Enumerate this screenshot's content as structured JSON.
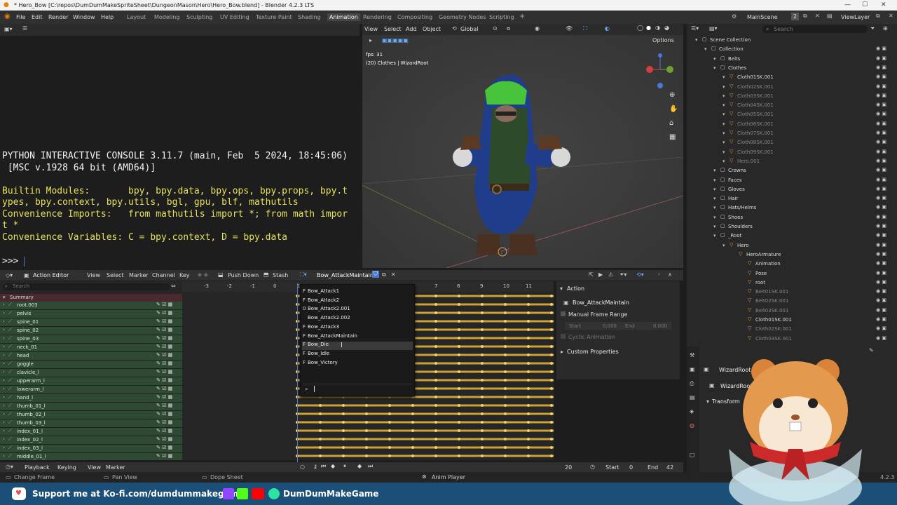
{
  "window": {
    "title": "* Hero_Bow [C:\\repos\\DumDumMakeSpriteSheet\\DungeonMason\\Hero\\Hero_Bow.blend] - Blender 4.2.3 LTS"
  },
  "menubar": {
    "items": [
      "File",
      "Edit",
      "Render",
      "Window",
      "Help"
    ],
    "workspaces": [
      "Layout",
      "Modeling",
      "Sculpting",
      "UV Editing",
      "Texture Paint",
      "Shading",
      "Animation",
      "Rendering",
      "Compositing",
      "Geometry Nodes",
      "Scripting"
    ],
    "active_workspace": "Animation",
    "add_tab": "+",
    "scene": "MainScene",
    "scene_count": "2",
    "view_layer": "ViewLayer"
  },
  "console": {
    "lines": [
      "PYTHON INTERACTIVE CONSOLE 3.11.7 (main, Feb  5 2024, 18:45:06)",
      " [MSC v.1928 64 bit (AMD64)]",
      "",
      "Builtin Modules:       bpy, bpy.data, bpy.ops, bpy.props, bpy.t",
      "ypes, bpy.context, bpy.utils, bgl, gpu, blf, mathutils",
      "Convenience Imports:   from mathutils import *; from math impor",
      "t *",
      "Convenience Variables: C = bpy.context, D = bpy.data"
    ],
    "prompt": ">>> "
  },
  "viewport": {
    "menu": [
      "View",
      "Select",
      "Add",
      "Object"
    ],
    "orientation": "Global",
    "options": "Options",
    "fps": "fps: 31",
    "info": "(20) Clothes | WizardRoot"
  },
  "outliner": {
    "search_placeholder": "Search",
    "rows": [
      {
        "label": "Scene Collection",
        "indent": 0,
        "dim": false
      },
      {
        "label": "Collection",
        "indent": 1,
        "dim": false
      },
      {
        "label": "Belts",
        "indent": 2,
        "dim": false
      },
      {
        "label": "Clothes",
        "indent": 2,
        "dim": false
      },
      {
        "label": "Cloth01SK.001",
        "indent": 3,
        "dim": false
      },
      {
        "label": "Cloth02SK.001",
        "indent": 3,
        "dim": true
      },
      {
        "label": "Cloth03SK.001",
        "indent": 3,
        "dim": true
      },
      {
        "label": "Cloth04SK.001",
        "indent": 3,
        "dim": true
      },
      {
        "label": "Cloth05SK.001",
        "indent": 3,
        "dim": true
      },
      {
        "label": "Cloth06SK.001",
        "indent": 3,
        "dim": true
      },
      {
        "label": "Cloth07SK.001",
        "indent": 3,
        "dim": true
      },
      {
        "label": "Cloth08SK.001",
        "indent": 3,
        "dim": true
      },
      {
        "label": "Cloth09SK.001",
        "indent": 3,
        "dim": true
      },
      {
        "label": "Hero.001",
        "indent": 3,
        "dim": true
      },
      {
        "label": "Crowns",
        "indent": 2,
        "dim": false
      },
      {
        "label": "Faces",
        "indent": 2,
        "dim": false
      },
      {
        "label": "Gloves",
        "indent": 2,
        "dim": false
      },
      {
        "label": "Hair",
        "indent": 2,
        "dim": false
      },
      {
        "label": "Hats/Helms",
        "indent": 2,
        "dim": false
      },
      {
        "label": "Shoes",
        "indent": 2,
        "dim": false
      },
      {
        "label": "Shoulders",
        "indent": 2,
        "dim": false
      },
      {
        "label": "_Root",
        "indent": 2,
        "dim": false
      },
      {
        "label": "Hero",
        "indent": 3,
        "dim": false
      },
      {
        "label": "HeroArmature",
        "indent": 4,
        "dim": false
      },
      {
        "label": "Animation",
        "indent": 5,
        "dim": false
      },
      {
        "label": "Pose",
        "indent": 5,
        "dim": false
      },
      {
        "label": "root",
        "indent": 5,
        "dim": false
      },
      {
        "label": "Belt01SK.001",
        "indent": 5,
        "dim": true
      },
      {
        "label": "Belt02SK.001",
        "indent": 5,
        "dim": true
      },
      {
        "label": "Belt03SK.001",
        "indent": 5,
        "dim": true
      },
      {
        "label": "Cloth01SK.001",
        "indent": 5,
        "dim": false
      },
      {
        "label": "Cloth02SK.001",
        "indent": 5,
        "dim": true
      },
      {
        "label": "Cloth03SK.001",
        "indent": 5,
        "dim": true
      }
    ]
  },
  "properties": {
    "object_name": "WizardRoot",
    "data_name": "WizardRoot",
    "panel": "Transform"
  },
  "action_editor": {
    "mode": "Action Editor",
    "menu": [
      "View",
      "Select",
      "Marker",
      "Channel",
      "Key"
    ],
    "push_down": "Push Down",
    "stash": "Stash",
    "action": "Bow_AttackMaintain",
    "search_placeholder": "Search",
    "summary": "Summary",
    "channels": [
      "root.003",
      "pelvis",
      "spine_01",
      "spine_02",
      "spine_03",
      "neck_01",
      "head",
      "goggle",
      "clavicle_l",
      "upperarm_l",
      "lowerarm_l",
      "hand_l",
      "thumb_01_l",
      "thumb_02_l",
      "thumb_03_l",
      "index_01_l",
      "index_02_l",
      "index_03_l",
      "middle_01_l"
    ],
    "ruler": [
      "-3",
      "-2",
      "-1",
      "0",
      "1",
      "7",
      "8",
      "9",
      "10",
      "11"
    ],
    "dropdown_items": [
      {
        "prefix": "F",
        "label": "Bow_Attack1"
      },
      {
        "prefix": "F",
        "label": "Bow_Attack2"
      },
      {
        "prefix": "0",
        "label": "Bow_Attack2.001"
      },
      {
        "prefix": "",
        "label": "Bow_Attack2.002"
      },
      {
        "prefix": "F",
        "label": "Bow_Attack3"
      },
      {
        "prefix": "F",
        "label": "Bow_AttackMaintain"
      },
      {
        "prefix": "F",
        "label": "Bow_Die"
      },
      {
        "prefix": "F",
        "label": "Bow_Idle"
      },
      {
        "prefix": "F",
        "label": "Bow_Victory"
      }
    ],
    "side_panel": {
      "header": "Action",
      "action_name": "Bow_AttackMaintain",
      "manual_frame_range": "Manual Frame Range",
      "start_label": "Start",
      "start_value": "0.000",
      "end_label": "End",
      "end_value": "0.000",
      "cyclic": "Cyclic Animation",
      "custom_properties": "Custom Properties"
    }
  },
  "timeline": {
    "menu": [
      "Playback",
      "Keying",
      "View",
      "Marker"
    ],
    "current_frame": "20",
    "start_label": "Start",
    "start_value": "0",
    "end_label": "End",
    "end_value": "42"
  },
  "status": {
    "left": "Change Frame",
    "mid": "Pan View",
    "right": "Dope Sheet",
    "player": "Anim Player",
    "version": "4.2.3"
  },
  "banner": {
    "kofi": "Support me at Ko-fi.com/dumdummakegame",
    "channel": "DumDumMakeGame"
  },
  "colors": {
    "accent": "#4b7ad1",
    "keyframe": "#e8b93a",
    "channel_green": "#2f4a33",
    "banner": "#1b4f78"
  }
}
